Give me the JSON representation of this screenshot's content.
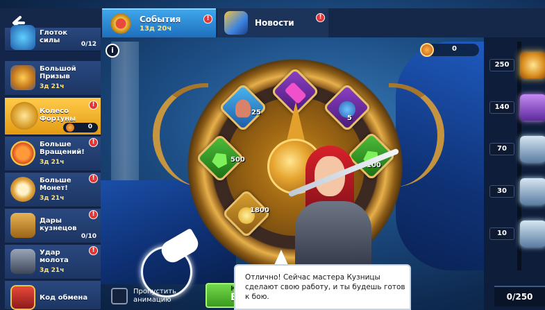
{
  "header": {
    "back_icon": "back-arrow-icon",
    "tabs": [
      {
        "label": "События",
        "timer": "13д 20ч",
        "icon": "crest-icon",
        "has_alert": true,
        "active": true
      },
      {
        "label": "Новости",
        "icon": "megaphone-icon",
        "has_alert": true,
        "active": false
      }
    ],
    "alert_mark": "!"
  },
  "sidebar": {
    "items": [
      {
        "label": "Глоток силы",
        "count": "0/12",
        "icon": "potion-icon"
      },
      {
        "label": "Большой Призыв",
        "time": "3д 21ч",
        "icon": "summon-icon"
      },
      {
        "label": "Колесо Фортуны",
        "count": "0",
        "icon": "fortune-wheel-icon",
        "active": true,
        "has_alert": true
      },
      {
        "label": "Больше Вращений!",
        "time": "3д 21ч",
        "icon": "spin-icon",
        "has_alert": true
      },
      {
        "label": "Больше Монет!",
        "time": "3д 21ч",
        "icon": "clock-coin-icon",
        "has_alert": true
      },
      {
        "label": "Дары кузнецов",
        "count": "0/10",
        "icon": "coins-stack-icon",
        "has_alert": true
      },
      {
        "label": "Удар молота",
        "time": "3д 21ч",
        "icon": "anvil-icon",
        "has_alert": true
      },
      {
        "label": "Код обмена",
        "icon": "gift-icon"
      }
    ]
  },
  "wheel": {
    "info_label": "i",
    "currency_value": "0",
    "slots": [
      {
        "label": "25",
        "icon": "figure-icon"
      },
      {
        "label": "",
        "icon": "scroll-icon"
      },
      {
        "label": "5",
        "icon": "potion-bottles-icon"
      },
      {
        "label": "100",
        "icon": "emerald-icon"
      },
      {
        "label": "500",
        "icon": "emerald-icon"
      },
      {
        "label": "1800",
        "icon": "gold-coin-icon"
      }
    ]
  },
  "rewards": {
    "tiers": [
      {
        "value": "250",
        "icon": "legendary-chest-icon"
      },
      {
        "value": "140",
        "icon": "epic-chest-icon"
      },
      {
        "value": "70",
        "icon": "silver-chest-icon"
      },
      {
        "value": "30",
        "icon": "silver-chest-icon"
      },
      {
        "value": "10",
        "icon": "silver-chest-icon"
      }
    ],
    "progress": "0/250"
  },
  "controls": {
    "skip_label": "Пропустить анимацию",
    "spin_button_top": "Кр",
    "spin_button_bottom": "Бе"
  },
  "dialog": {
    "text": "Отлично! Сейчас мастера Кузницы сделают свою работу, и ты будешь готов к бою."
  },
  "colors": {
    "active_tab": "#2f8ddb",
    "active_sidebar": "#f5b52e",
    "alert": "#e23535",
    "timer_text": "#ffe27a",
    "button_green": "#5cc23a"
  }
}
